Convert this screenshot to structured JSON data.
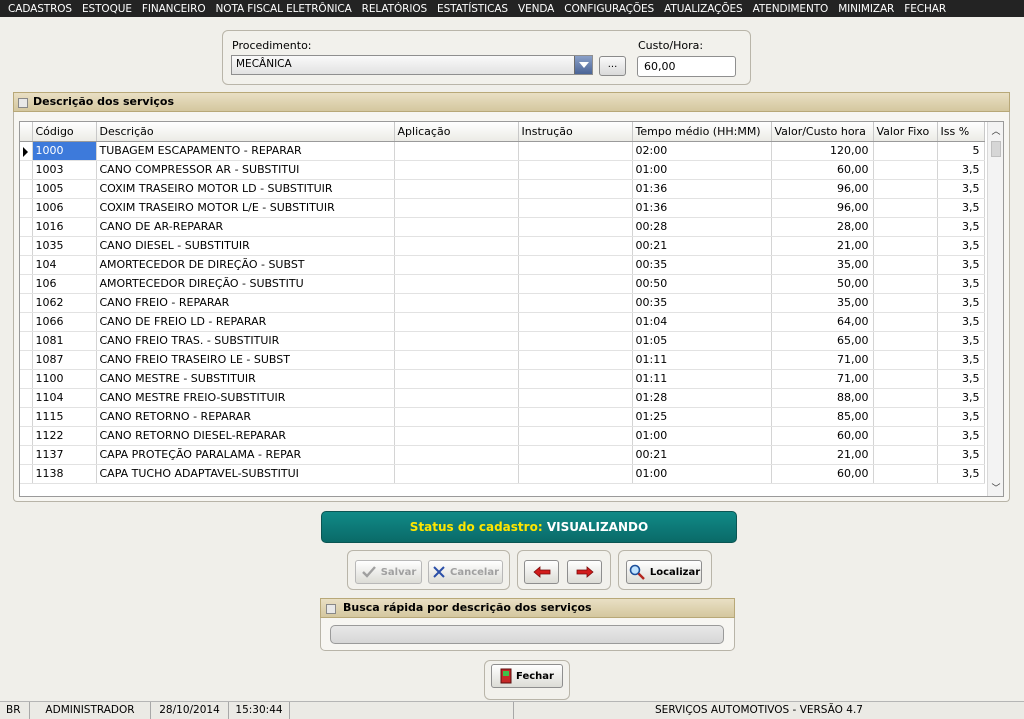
{
  "menu": [
    "CADASTROS",
    "ESTOQUE",
    "FINANCEIRO",
    "NOTA FISCAL ELETRÔNICA",
    "RELATÓRIOS",
    "ESTATÍSTICAS",
    "VENDA",
    "CONFIGURAÇÕES",
    "ATUALIZAÇÕES",
    "ATENDIMENTO",
    "MINIMIZAR",
    "FECHAR"
  ],
  "form": {
    "procedimento_label": "Procedimento:",
    "procedimento_value": "MECÂNICA",
    "dots_label": "...",
    "custo_label": "Custo/Hora:",
    "custo_value": "60,00"
  },
  "services": {
    "title": "Descrição dos serviços",
    "columns": [
      "Código",
      "Descrição",
      "Aplicação",
      "Instrução",
      "Tempo médio (HH:MM)",
      "Valor/Custo hora",
      "Valor Fixo",
      "Iss %"
    ],
    "rows": [
      {
        "codigo": "1000",
        "descricao": "TUBAGEM ESCAPAMENTO - REPARAR",
        "aplicacao": "",
        "instrucao": "",
        "tempo": "02:00",
        "valor": "120,00",
        "fixo": "",
        "iss": "5",
        "selected": true
      },
      {
        "codigo": "1003",
        "descricao": "CANO COMPRESSOR AR - SUBSTITUI",
        "aplicacao": "",
        "instrucao": "",
        "tempo": "01:00",
        "valor": "60,00",
        "fixo": "",
        "iss": "3,5"
      },
      {
        "codigo": "1005",
        "descricao": "COXIM TRASEIRO MOTOR LD - SUBSTITUIR",
        "aplicacao": "",
        "instrucao": "",
        "tempo": "01:36",
        "valor": "96,00",
        "fixo": "",
        "iss": "3,5"
      },
      {
        "codigo": "1006",
        "descricao": "COXIM TRASEIRO MOTOR L/E - SUBSTITUIR",
        "aplicacao": "",
        "instrucao": "",
        "tempo": "01:36",
        "valor": "96,00",
        "fixo": "",
        "iss": "3,5"
      },
      {
        "codigo": "1016",
        "descricao": "CANO DE AR-REPARAR",
        "aplicacao": "",
        "instrucao": "",
        "tempo": "00:28",
        "valor": "28,00",
        "fixo": "",
        "iss": "3,5"
      },
      {
        "codigo": "1035",
        "descricao": "CANO DIESEL - SUBSTITUIR",
        "aplicacao": "",
        "instrucao": "",
        "tempo": "00:21",
        "valor": "21,00",
        "fixo": "",
        "iss": "3,5"
      },
      {
        "codigo": "104",
        "descricao": "AMORTECEDOR DE DIREÇÃO - SUBST",
        "aplicacao": "",
        "instrucao": "",
        "tempo": "00:35",
        "valor": "35,00",
        "fixo": "",
        "iss": "3,5"
      },
      {
        "codigo": "106",
        "descricao": "AMORTECEDOR DIREÇÃO - SUBSTITU",
        "aplicacao": "",
        "instrucao": "",
        "tempo": "00:50",
        "valor": "50,00",
        "fixo": "",
        "iss": "3,5"
      },
      {
        "codigo": "1062",
        "descricao": "CANO FREIO - REPARAR",
        "aplicacao": "",
        "instrucao": "",
        "tempo": "00:35",
        "valor": "35,00",
        "fixo": "",
        "iss": "3,5"
      },
      {
        "codigo": "1066",
        "descricao": "CANO DE FREIO LD - REPARAR",
        "aplicacao": "",
        "instrucao": "",
        "tempo": "01:04",
        "valor": "64,00",
        "fixo": "",
        "iss": "3,5"
      },
      {
        "codigo": "1081",
        "descricao": "CANO FREIO TRAS. - SUBSTITUIR",
        "aplicacao": "",
        "instrucao": "",
        "tempo": "01:05",
        "valor": "65,00",
        "fixo": "",
        "iss": "3,5"
      },
      {
        "codigo": "1087",
        "descricao": "CANO FREIO TRASEIRO LE - SUBST",
        "aplicacao": "",
        "instrucao": "",
        "tempo": "01:11",
        "valor": "71,00",
        "fixo": "",
        "iss": "3,5"
      },
      {
        "codigo": "1100",
        "descricao": "CANO MESTRE - SUBSTITUIR",
        "aplicacao": "",
        "instrucao": "",
        "tempo": "01:11",
        "valor": "71,00",
        "fixo": "",
        "iss": "3,5"
      },
      {
        "codigo": "1104",
        "descricao": "CANO MESTRE FREIO-SUBSTITUIR",
        "aplicacao": "",
        "instrucao": "",
        "tempo": "01:28",
        "valor": "88,00",
        "fixo": "",
        "iss": "3,5"
      },
      {
        "codigo": "1115",
        "descricao": "CANO RETORNO - REPARAR",
        "aplicacao": "",
        "instrucao": "",
        "tempo": "01:25",
        "valor": "85,00",
        "fixo": "",
        "iss": "3,5"
      },
      {
        "codigo": "1122",
        "descricao": "CANO RETORNO DIESEL-REPARAR",
        "aplicacao": "",
        "instrucao": "",
        "tempo": "01:00",
        "valor": "60,00",
        "fixo": "",
        "iss": "3,5"
      },
      {
        "codigo": "1137",
        "descricao": "CAPA PROTEÇÃO PARALAMA - REPAR",
        "aplicacao": "",
        "instrucao": "",
        "tempo": "00:21",
        "valor": "21,00",
        "fixo": "",
        "iss": "3,5"
      },
      {
        "codigo": "1138",
        "descricao": "CAPA TUCHO ADAPTAVEL-SUBSTITUI",
        "aplicacao": "",
        "instrucao": "",
        "tempo": "01:00",
        "valor": "60,00",
        "fixo": "",
        "iss": "3,5"
      }
    ]
  },
  "status": {
    "label": "Status do cadastro:",
    "value": "VISUALIZANDO",
    "bg_color": "#0d7a78",
    "label_color": "#ffe600"
  },
  "buttons": {
    "salvar": "Salvar",
    "cancelar": "Cancelar",
    "localizar": "Localizar",
    "fechar": "Fechar"
  },
  "icons": {
    "salvar": "checkmark-icon",
    "cancelar": "x-icon",
    "prev": "arrow-left-icon",
    "next": "arrow-right-icon",
    "localizar": "magnifier-icon",
    "fechar": "door-exit-icon"
  },
  "busca": {
    "title": "Busca rápida por descrição dos serviços",
    "value": ""
  },
  "statusbar": {
    "lang": "BR",
    "user": "ADMINISTRADOR",
    "date": "28/10/2014",
    "time": "15:30:44",
    "empty": "",
    "version": "SERVIÇOS AUTOMOTIVOS - VERSÃO 4.7"
  }
}
